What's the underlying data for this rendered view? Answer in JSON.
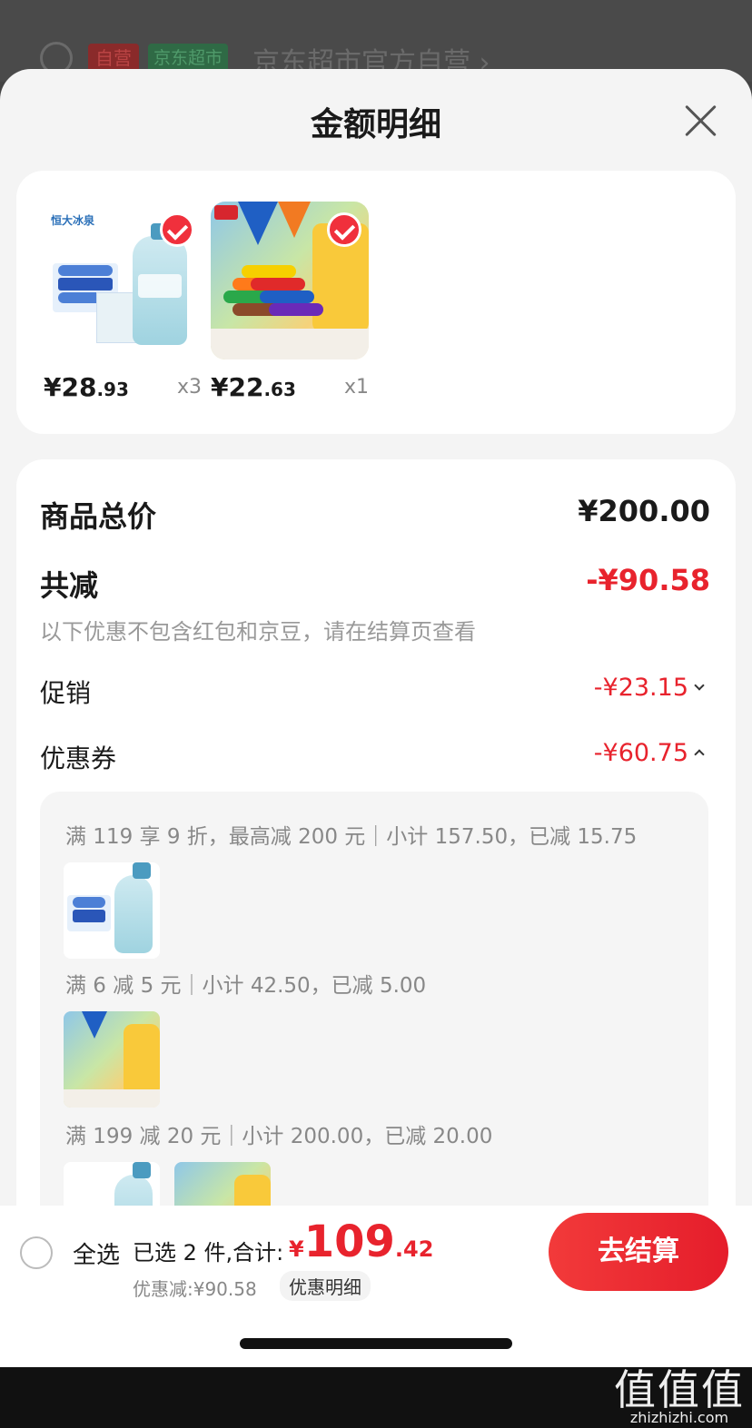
{
  "backdrop": {
    "tag_self": "自营",
    "tag_market": "京东超市",
    "store_name": "京东超市官方自营 ›"
  },
  "sheet": {
    "title": "金额明细"
  },
  "products": [
    {
      "name_logo": "恒大冰泉",
      "price_int": "¥28",
      "price_dec": ".93",
      "qty": "x3"
    },
    {
      "name_logo": "deli",
      "price_int": "¥22",
      "price_dec": ".63",
      "qty": "x1"
    }
  ],
  "summary": {
    "total_label": "商品总价",
    "total_value": "¥200.00",
    "saved_label": "共减",
    "saved_value": "-¥90.58",
    "note": "以下优惠不包含红包和京豆，请在结算页查看",
    "promo_label": "促销",
    "promo_value": "-¥23.15",
    "coupon_label": "优惠券",
    "coupon_value": "-¥60.75"
  },
  "coupons": [
    "满 119 享 9 折，最高减 200 元｜小计 157.50，已减 15.75",
    "满 6 减 5 元｜小计 42.50，已减 5.00",
    "满 199 减 20 元｜小计 200.00，已减 20.00"
  ],
  "bottom": {
    "select_all": "全选",
    "selected": "已选 2 件,合计:",
    "currency": "¥",
    "amount_int": "109",
    "amount_dec": ".42",
    "discount": "优惠减:¥90.58",
    "detail_link": "优惠明细",
    "checkout": "去结算"
  },
  "watermark": {
    "mark": "值值值",
    "url": "zhizhizhi.com"
  },
  "colors": {
    "accent": "#e8232d",
    "sheet_bg": "#f4f4f4"
  }
}
